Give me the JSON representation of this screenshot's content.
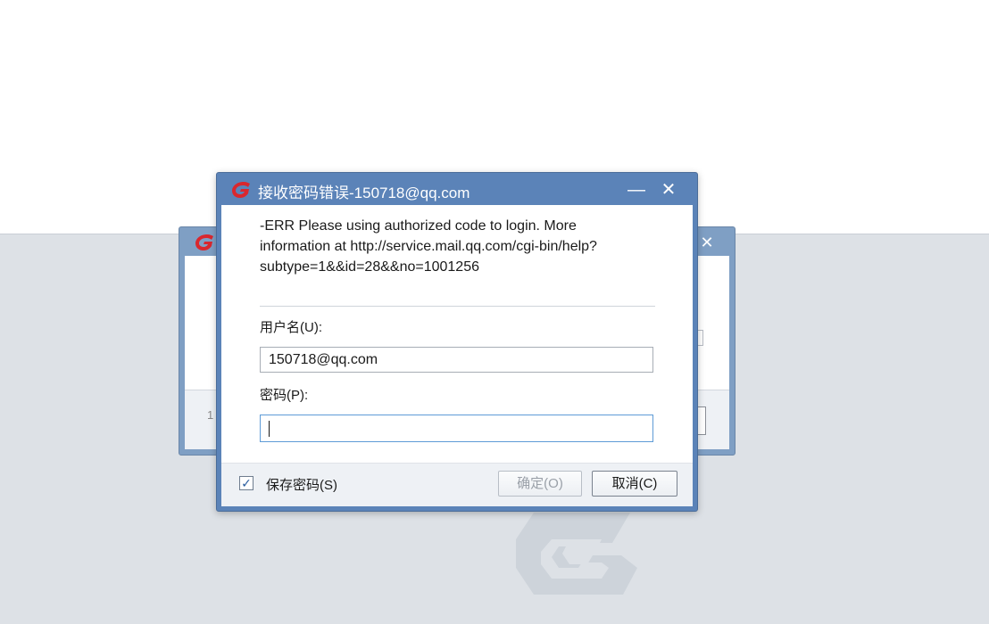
{
  "colors": {
    "titlebar": "#5b83b8",
    "footer": "#eef1f5",
    "background_gray": "#dde1e6",
    "logo_red": "#d9272e",
    "focus_border": "#5e9bd6"
  },
  "icons": {
    "app_logo": "red-g-logo-icon",
    "minimize": "minimize-icon",
    "close": "close-icon",
    "watermark": "g-logo-watermark-icon"
  },
  "background_dialog": {
    "close_glyph": "✕",
    "fragment_text": "1"
  },
  "dialog": {
    "title": "接收密码错误-150718@qq.com",
    "minimize_glyph": "—",
    "close_glyph": "✕",
    "error_message": "-ERR Please using authorized code to login. More information at http://service.mail.qq.com/cgi-bin/help?subtype=1&&id=28&&no=1001256",
    "username_label": "用户名(U):",
    "username_value": "150718@qq.com",
    "password_label": "密码(P):",
    "password_value": "",
    "save_password_label": "保存密码(S)",
    "save_password_checked": true,
    "check_glyph": "✓",
    "ok_label": "确定(O)",
    "cancel_label": "取消(C)"
  }
}
